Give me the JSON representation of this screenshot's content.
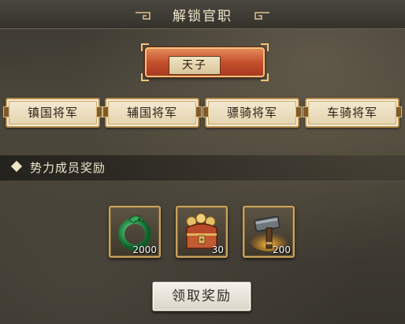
{
  "header": {
    "title": "解锁官职"
  },
  "featured_rank": {
    "label": "天子"
  },
  "ranks": [
    {
      "label": "镇国将军"
    },
    {
      "label": "辅国将军"
    },
    {
      "label": "骠骑将军"
    },
    {
      "label": "车骑将军"
    }
  ],
  "rewards_section": {
    "title": "势力成员奖励",
    "items": [
      {
        "icon": "jade-dragon-icon",
        "quantity": "2000"
      },
      {
        "icon": "treasure-chest-icon",
        "quantity": "30"
      },
      {
        "icon": "hammer-icon",
        "quantity": "200"
      }
    ]
  },
  "actions": {
    "claim_label": "领取奖励"
  }
}
